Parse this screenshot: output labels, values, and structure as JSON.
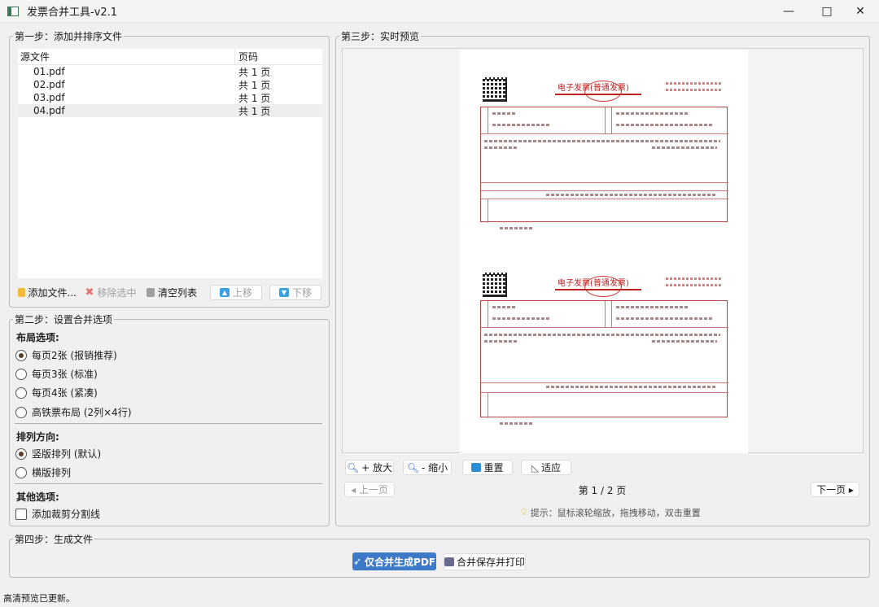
{
  "window": {
    "title": "发票合并工具-v2.1",
    "minimize": "—",
    "maximize": "□",
    "close": "✕"
  },
  "step1": {
    "legend": "第一步：添加并排序文件",
    "columns": [
      "源文件",
      "页码"
    ],
    "files": [
      {
        "name": "01.pdf",
        "pages": "共 1 页"
      },
      {
        "name": "02.pdf",
        "pages": "共 1 页"
      },
      {
        "name": "03.pdf",
        "pages": "共 1 页"
      },
      {
        "name": "04.pdf",
        "pages": "共 1 页"
      }
    ],
    "buttons": {
      "add": "添加文件...",
      "remove": "移除选中",
      "clear": "清空列表",
      "up": "上移",
      "down": "下移"
    }
  },
  "step2": {
    "legend": "第二步：设置合并选项",
    "layout_heading": "布局选项:",
    "layout_options": [
      "每页2张 (报销推荐)",
      "每页3张 (标准)",
      "每页4张 (紧凑)",
      "高铁票布局 (2列×4行)"
    ],
    "layout_selected": "每页2张 (报销推荐)",
    "direction_heading": "排列方向:",
    "direction_options": [
      "竖版排列 (默认)",
      "横版排列"
    ],
    "direction_selected": "竖版排列 (默认)",
    "other_heading": "其他选项:",
    "cut_line_label": "添加裁剪分割线",
    "cut_line_checked": false
  },
  "step3": {
    "legend": "第三步：实时预览",
    "invoice_title": "电子发票(普通发票)",
    "zoom_in": "+ 放大",
    "zoom_out": "- 缩小",
    "reset": "重置",
    "fit": "适应",
    "prev": "◂ 上一页",
    "next": "下一页 ▸",
    "page_indicator": "第 1 / 2 页",
    "hint": "提示：鼠标滚轮缩放，拖拽移动，双击重置"
  },
  "step4": {
    "legend": "第四步：生成文件",
    "merge_pdf": "仅合并生成PDF",
    "merge_print": "合并保存并打印"
  },
  "status": "高清预览已更新。",
  "colors": {
    "primary": "#3d79c9",
    "invoice_red": "#b22222"
  }
}
